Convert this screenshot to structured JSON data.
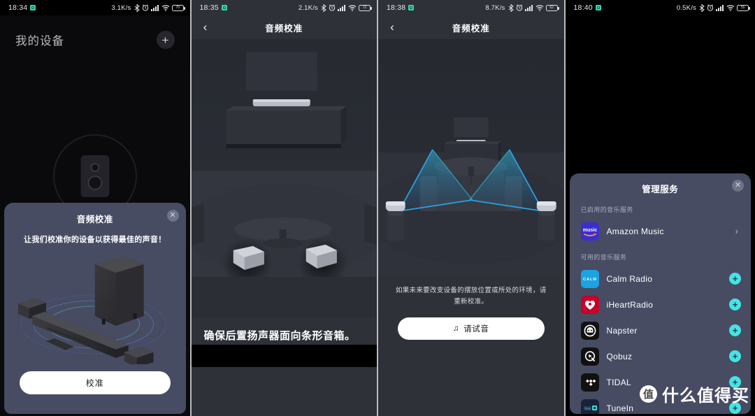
{
  "panels": [
    {
      "status": {
        "time": "18:34",
        "speed": "3.1K/s",
        "battery": "70"
      },
      "page_title": "我的设备",
      "add_button": "+",
      "sheet": {
        "title": "音频校准",
        "close": "✕",
        "subtitle": "让我们校准你的设备以获得最佳的声音！",
        "cta": "校准"
      }
    },
    {
      "status": {
        "time": "18:35",
        "speed": "2.1K/s",
        "battery": "72"
      },
      "nav": {
        "back": "‹",
        "title": "音频校准"
      },
      "caption": "确保后置扬声器面向条形音箱。"
    },
    {
      "status": {
        "time": "18:38",
        "speed": "8.7K/s",
        "battery": "62"
      },
      "nav": {
        "back": "‹",
        "title": "音频校准"
      },
      "caption": "如果未来要改变设备的摆放位置或所处的环境，请重新校准。",
      "cta": "请试音",
      "cta_icon": "♫"
    },
    {
      "status": {
        "time": "18:40",
        "speed": "0.5K/s",
        "battery": "55"
      },
      "sheet": {
        "title": "管理服务",
        "close": "✕",
        "enabled_label": "已启用的音乐服务",
        "available_label": "可用的音乐服务",
        "enabled": [
          {
            "name": "Amazon Music",
            "icon": "amazon-music-icon",
            "action": "›"
          }
        ],
        "available": [
          {
            "name": "Calm Radio",
            "icon": "calm-radio-icon",
            "action": "+"
          },
          {
            "name": "iHeartRadio",
            "icon": "iheartradio-icon",
            "action": "+"
          },
          {
            "name": "Napster",
            "icon": "napster-icon",
            "action": "+"
          },
          {
            "name": "Qobuz",
            "icon": "qobuz-icon",
            "action": "+"
          },
          {
            "name": "TIDAL",
            "icon": "tidal-icon",
            "action": "+"
          },
          {
            "name": "TuneIn",
            "icon": "tunein-icon",
            "action": "+"
          }
        ]
      }
    }
  ],
  "watermark": {
    "logo": "值",
    "text": "什么值得买"
  },
  "colors": {
    "sheet_bg": "#474c63",
    "accent_cyan": "#45e3e3",
    "sound_cone": "#1f8fd6",
    "scene_bg": "#2b2e35"
  }
}
